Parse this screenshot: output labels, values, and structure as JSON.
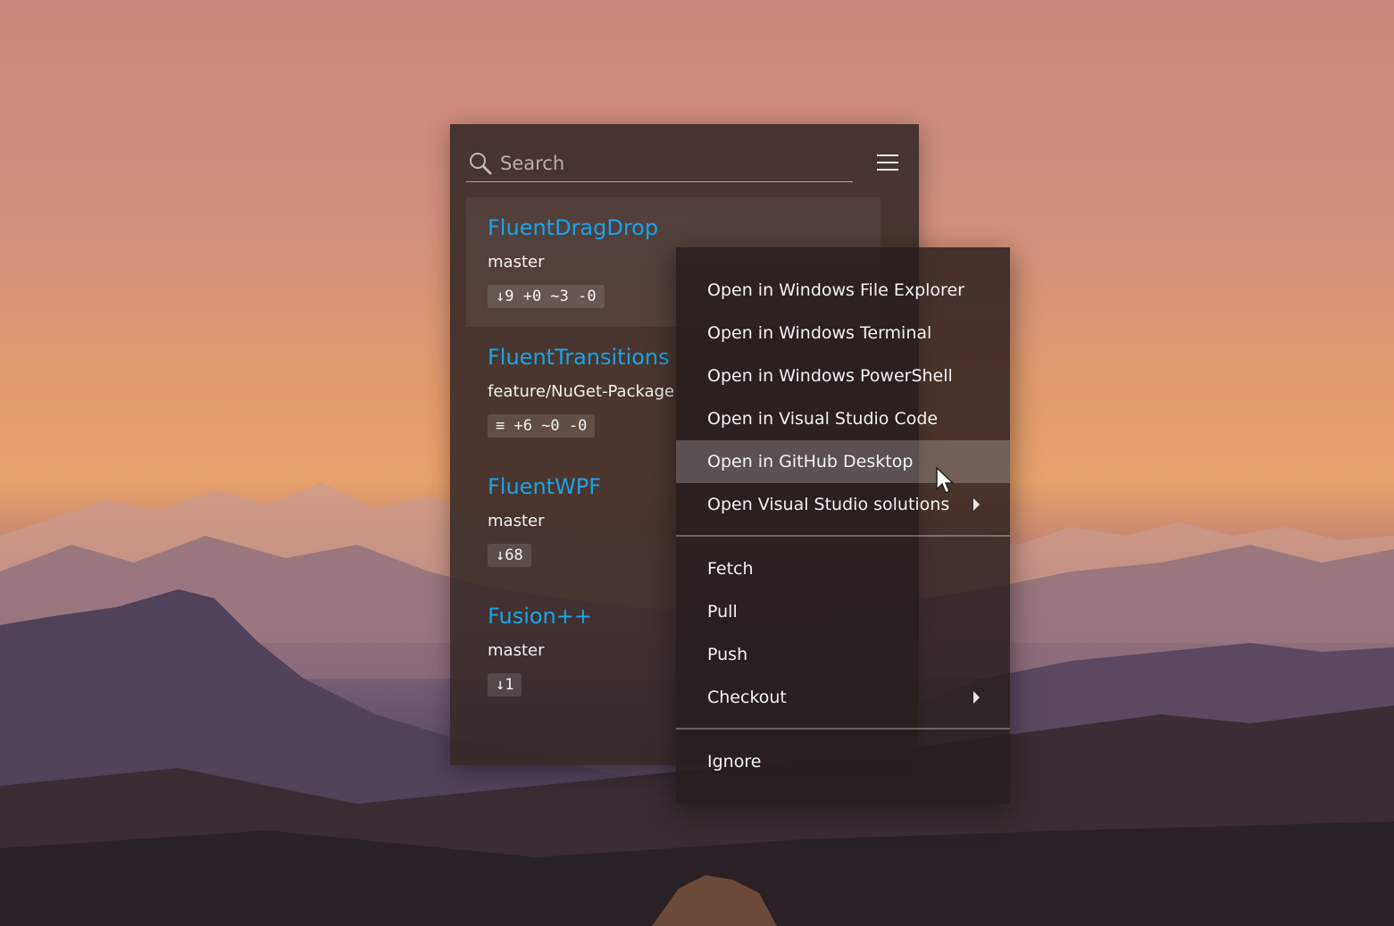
{
  "search": {
    "placeholder": "Search"
  },
  "header": {
    "menu_icon": "hamburger-menu-icon"
  },
  "repos": [
    {
      "name": "FluentDragDrop",
      "branch": "master",
      "status": "↓9 +0 ~3 -0",
      "selected": true
    },
    {
      "name": "FluentTransitions",
      "branch": "feature/NuGet-Package",
      "status": "≡ +6 ~0 -0",
      "selected": false
    },
    {
      "name": "FluentWPF",
      "branch": "master",
      "status": "↓68",
      "selected": false
    },
    {
      "name": "Fusion++",
      "branch": "master",
      "status": "↓1",
      "selected": false
    }
  ],
  "context_menu": {
    "groups": [
      [
        "Open in Windows File Explorer",
        "Open in Windows Terminal",
        "Open in Windows PowerShell",
        "Open in Visual Studio Code",
        "Open in GitHub Desktop",
        "Open Visual Studio solutions"
      ],
      [
        "Fetch",
        "Pull",
        "Push",
        "Checkout"
      ],
      [
        "Ignore"
      ]
    ],
    "hovered": "Open in GitHub Desktop",
    "submenu_items": [
      "Open Visual Studio solutions",
      "Checkout"
    ]
  },
  "colors": {
    "repo_name": "#1aa3e8",
    "window_bg": "#342826",
    "menu_bg": "#261c1c"
  }
}
